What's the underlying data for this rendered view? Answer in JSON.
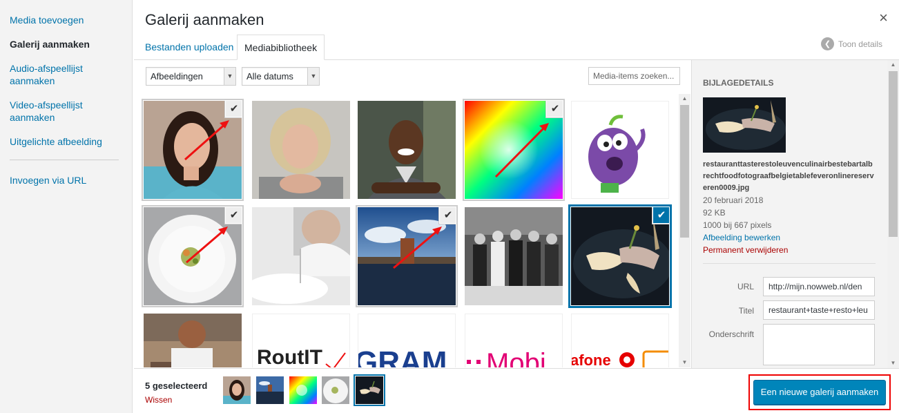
{
  "menu": {
    "items": [
      {
        "label": "Media toevoegen",
        "active": false
      },
      {
        "label": "Galerij aanmaken",
        "active": true
      },
      {
        "label": "Audio-afspeellijst aanmaken",
        "active": false
      },
      {
        "label": "Video-afspeellijst aanmaken",
        "active": false
      },
      {
        "label": "Uitgelichte afbeelding",
        "active": false
      }
    ],
    "url_item": "Invoegen via URL"
  },
  "header": {
    "title": "Galerij aanmaken",
    "close_glyph": "×",
    "tabs": {
      "upload": "Bestanden uploaden",
      "library": "Mediabibliotheek"
    },
    "toon_details": "Toon details"
  },
  "toolbar": {
    "type_filter": "Afbeeldingen",
    "date_filter": "Alle datums",
    "search_placeholder": "Media-items zoeken..."
  },
  "grid": {
    "tiles": [
      {
        "name": "portrait-woman-brunette",
        "selected": true
      },
      {
        "name": "portrait-woman-blonde",
        "selected": false
      },
      {
        "name": "portrait-man-smiling",
        "selected": false
      },
      {
        "name": "color-wheel",
        "selected": true
      },
      {
        "name": "purple-cartoon-character",
        "selected": false
      },
      {
        "name": "plated-dish-white",
        "selected": true
      },
      {
        "name": "chef-plating",
        "selected": false
      },
      {
        "name": "city-waterfront",
        "selected": true
      },
      {
        "name": "group-photo-bw",
        "selected": false
      },
      {
        "name": "plated-dish-dark",
        "selected": true
      },
      {
        "name": "chef-portrait",
        "selected": false
      },
      {
        "name": "routit-logo",
        "selected": false,
        "text": "RoutIT"
      },
      {
        "name": "gram-logo",
        "selected": false,
        "text": "GRAM"
      },
      {
        "name": "tmobile-logo",
        "selected": false,
        "text": "Mobi"
      },
      {
        "name": "vodafone-ziggo-logo",
        "selected": false,
        "text": "afone"
      }
    ]
  },
  "details": {
    "heading": "Bijlagedetails",
    "filename": "restauranttasterestoleuvenculinairbestebartalbrechtfoodfotograafbelgietablefeveronlinereserveren0009.jpg",
    "date": "20 februari 2018",
    "size": "92 KB",
    "dimensions": "1000 bij 667 pixels",
    "edit_link": "Afbeelding bewerken",
    "delete_link": "Permanent verwijderen",
    "url_label": "URL",
    "url_value": "http://mijn.nowweb.nl/den",
    "title_label": "Titel",
    "title_value": "restaurant+taste+resto+leu",
    "caption_label": "Onderschrift"
  },
  "bottom": {
    "selected_count": "5 geselecteerd",
    "clear_label": "Wissen",
    "create_button": "Een nieuwe galerij aanmaken"
  },
  "colors": {
    "link": "#0073aa",
    "primary_button": "#0085ba",
    "danger": "#aa0000",
    "highlight_box": "#ee0000"
  }
}
